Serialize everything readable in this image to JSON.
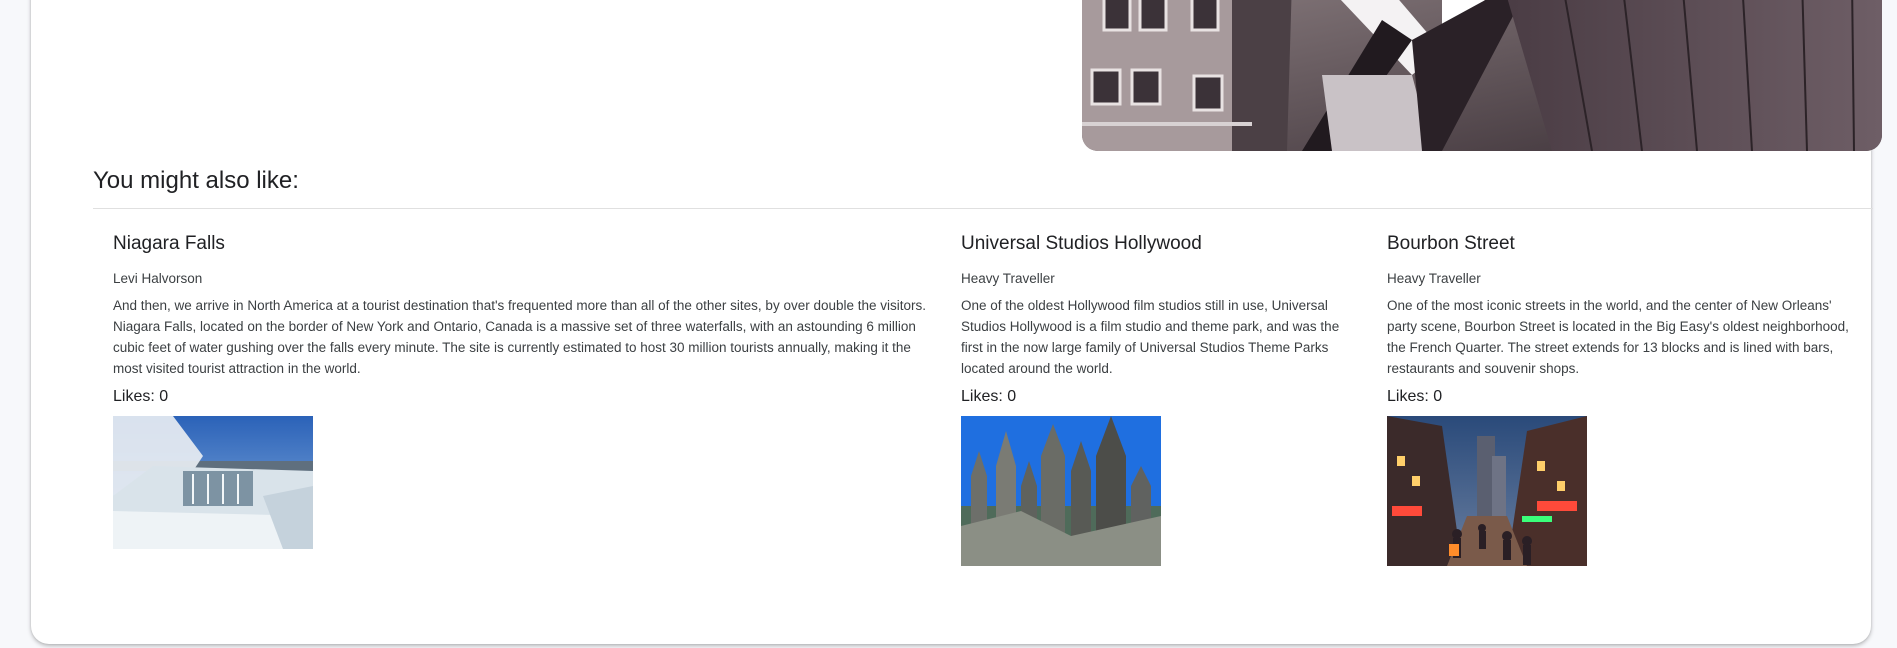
{
  "section": {
    "title": "You might also like:"
  },
  "recommendations": [
    {
      "title": "Niagara Falls",
      "author": "Levi Halvorson",
      "description": "And then, we arrive in North America at a tourist destination that's frequented more than all of the other sites, by over double the visitors. Niagara Falls, located on the border of New York and Ontario, Canada is a massive set of three waterfalls, with an astounding 6 million cubic feet of water gushing over the falls every minute. The site is currently estimated to host 30 million tourists annually, making it the most visited tourist attraction in the world.",
      "likes": "Likes: 0"
    },
    {
      "title": "Universal Studios Hollywood",
      "author": "Heavy Traveller",
      "description": "One of the oldest Hollywood film studios still in use, Universal Studios Hollywood is a film studio and theme park, and was the first in the now large family of Universal Studios Theme Parks located around the world.",
      "likes": "Likes: 0"
    },
    {
      "title": "Bourbon Street",
      "author": "Heavy Traveller",
      "description": "One of the most iconic streets in the world, and the center of New Orleans' party scene, Bourbon Street is located in the Big Easy's oldest neighborhood, the French Quarter. The street extends for 13 blocks and is lined with bars, restaurants and souvenir shops.",
      "likes": "Likes: 0"
    }
  ]
}
